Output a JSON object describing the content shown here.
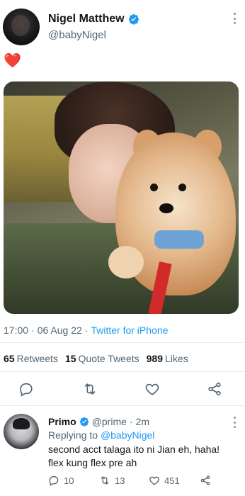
{
  "tweet": {
    "author_name": "Nigel Matthew",
    "author_handle": "@babyNigel",
    "text": "❤️",
    "time": "17:00",
    "date": "06 Aug 22",
    "separator": "·",
    "source": "Twitter for iPhone",
    "stats": {
      "retweets_count": "65",
      "retweets_label": "Retweets",
      "quotes_count": "15",
      "quotes_label": "Quote Tweets",
      "likes_count": "989",
      "likes_label": "Likes"
    },
    "actions": [
      "reply-icon",
      "retweet-icon",
      "like-icon",
      "share-icon"
    ]
  },
  "reply": {
    "author_name": "Primo",
    "author_handle": "@prime",
    "separator": "·",
    "time": "2m",
    "replying_to_label": "Replying to",
    "replying_to_handle": "@babyNigel",
    "text_line1": "second acct talaga ito ni Jian eh, haha!",
    "text_line2": "flex kung flex pre ah",
    "counts": {
      "replies": "10",
      "retweets": "13",
      "likes": "451"
    }
  },
  "colors": {
    "accent": "#1d9bf0",
    "heart": "#e0245e",
    "muted": "#536471"
  }
}
